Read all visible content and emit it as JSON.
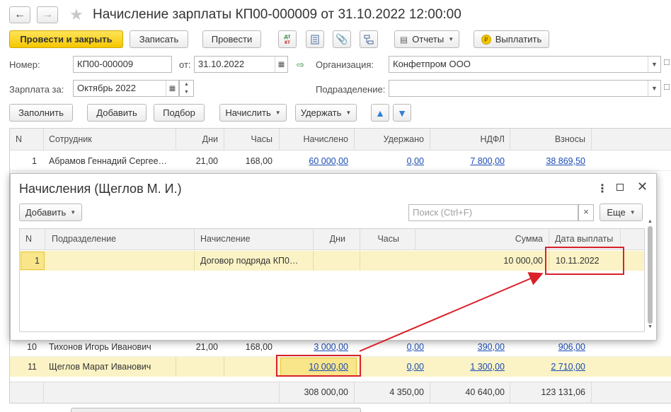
{
  "window": {
    "title": "Начисление зарплаты КП00-000009 от 31.10.2022 12:00:00"
  },
  "toolbar": {
    "post_close": "Провести и закрыть",
    "save": "Записать",
    "post": "Провести",
    "dtkt_top": "дт",
    "dtkt_bottom": "кт",
    "reports": "Отчеты",
    "pay": "Выплатить"
  },
  "form": {
    "number_label": "Номер:",
    "number": "КП00-000009",
    "date_label": "от:",
    "date": "31.10.2022",
    "org_label": "Организация:",
    "org": "Конфетпром ООО",
    "salary_for_label": "Зарплата за:",
    "salary_for": "Октябрь 2022",
    "dept_label": "Подразделение:",
    "dept": ""
  },
  "actions": {
    "fill": "Заполнить",
    "add": "Добавить",
    "select": "Подбор",
    "accrue": "Начислить",
    "withhold": "Удержать"
  },
  "table": {
    "headers": [
      "N",
      "Сотрудник",
      "Дни",
      "Часы",
      "Начислено",
      "Удержано",
      "НДФЛ",
      "Взносы"
    ],
    "rows": [
      {
        "n": "1",
        "name": "Абрамов Геннадий Сергее…",
        "days": "21,00",
        "hours": "168,00",
        "accrued": "60 000,00",
        "withheld": "0,00",
        "ndfl": "7 800,00",
        "contrib": "38 869,50"
      },
      {
        "n": "10",
        "name": "Тихонов Игорь Иванович",
        "days": "21,00",
        "hours": "168,00",
        "accrued": "3 000,00",
        "withheld": "0,00",
        "ndfl": "390,00",
        "contrib": "906,00"
      },
      {
        "n": "11",
        "name": "Щеглов Марат Иванович",
        "days": "",
        "hours": "",
        "accrued": "10 000,00",
        "withheld": "0,00",
        "ndfl": "1 300,00",
        "contrib": "2 710,00"
      }
    ],
    "totals": {
      "accrued": "308 000,00",
      "withheld": "4 350,00",
      "ndfl": "40 640,00",
      "contrib": "123 131,06"
    }
  },
  "dialog": {
    "title": "Начисления (Щеглов М. И.)",
    "add": "Добавить",
    "search_placeholder": "Поиск (Ctrl+F)",
    "search_clear": "×",
    "more": "Еще",
    "headers": [
      "N",
      "Подразделение",
      "Начисление",
      "Дни",
      "Часы",
      "Сумма",
      "Дата выплаты"
    ],
    "row": {
      "n": "1",
      "dept": "",
      "accrual": "Договор подряда КП0…",
      "days": "",
      "hours": "",
      "sum": "10 000,00",
      "pay_date": "10.11.2022"
    }
  },
  "colors": {
    "accent_yellow": "#f5c700",
    "selected_row": "#fbf3c5",
    "highlight_red": "#d9212b",
    "link": "#1a4bb5"
  }
}
